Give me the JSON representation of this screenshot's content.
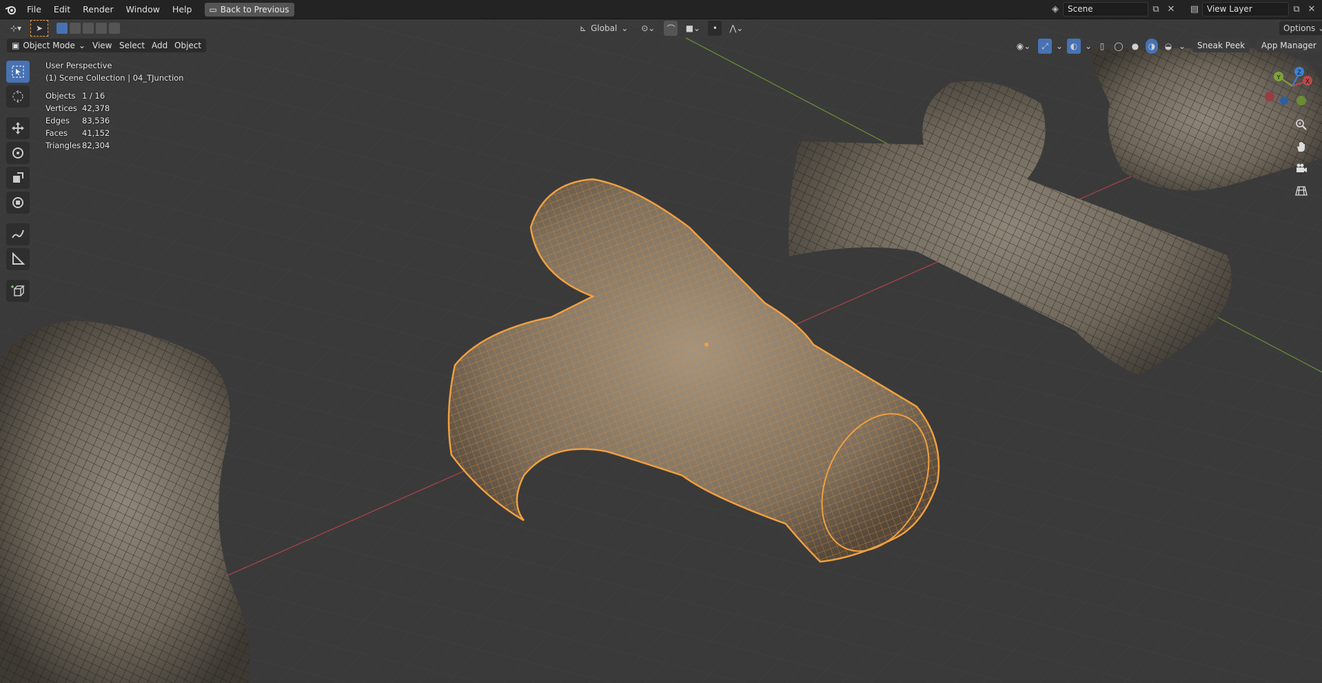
{
  "menu": [
    "File",
    "Edit",
    "Render",
    "Window",
    "Help"
  ],
  "back_button": "Back to Previous",
  "scene": {
    "label": "Scene"
  },
  "view_layer": {
    "label": "View Layer"
  },
  "header": {
    "mode": "Object Mode",
    "view": "View",
    "select": "Select",
    "add": "Add",
    "object": "Object",
    "transform_orientation": "Global",
    "options": "Options",
    "sneak_peek": "Sneak Peek",
    "app_manager": "App Manager"
  },
  "overlay": {
    "perspective": "User Perspective",
    "collection": "(1) Scene Collection | 04_TJunction",
    "stats": [
      {
        "label": "Objects",
        "value": "1 / 16"
      },
      {
        "label": "Vertices",
        "value": "42,378"
      },
      {
        "label": "Edges",
        "value": "83,536"
      },
      {
        "label": "Faces",
        "value": "41,152"
      },
      {
        "label": "Triangles",
        "value": "82,304"
      }
    ]
  },
  "gizmo_axes": {
    "x": "X",
    "y": "Y",
    "z": "Z"
  },
  "colors": {
    "accent": "#4772b3",
    "selection": "#f0a040",
    "x_axis": "#c0464e",
    "y_axis": "#7fa33a",
    "z_axis": "#3c82d8"
  }
}
